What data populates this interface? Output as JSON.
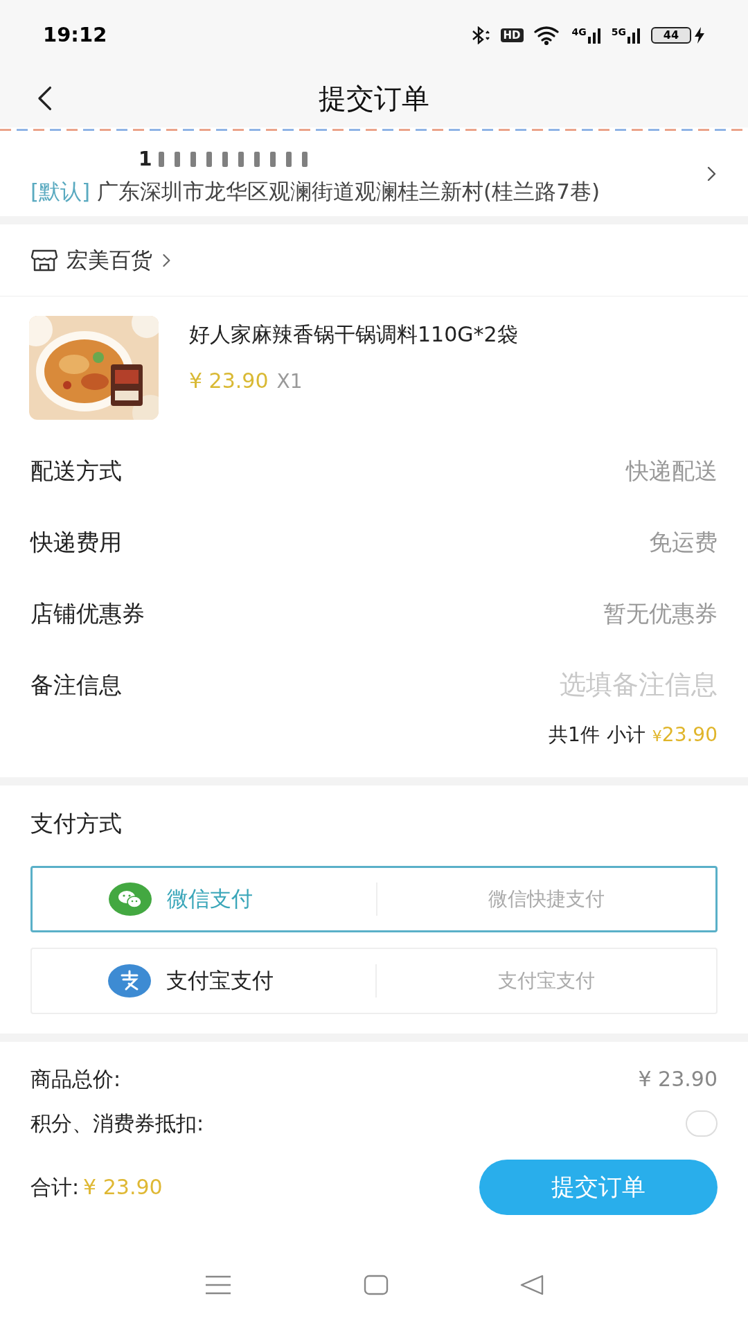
{
  "status_bar": {
    "time": "19:12",
    "hd": "HD",
    "networks": [
      "4G",
      "5G"
    ],
    "battery": "44"
  },
  "header": {
    "title": "提交订单"
  },
  "address": {
    "phone": "1",
    "tag": "[默认]",
    "text": "广东深圳市龙华区观澜街道观澜桂兰新村(桂兰路7巷)"
  },
  "shop": {
    "name": "宏美百货"
  },
  "product": {
    "name": "好人家麻辣香锅干锅调料110G*2袋",
    "price": "¥ 23.90",
    "quantity": "X1"
  },
  "details": [
    {
      "kind": "value",
      "label": "配送方式",
      "value": "快递配送"
    },
    {
      "kind": "value",
      "label": "快递费用",
      "value": "免运费"
    },
    {
      "kind": "value",
      "label": "店铺优惠券",
      "value": "暂无优惠券"
    },
    {
      "kind": "input",
      "label": "备注信息",
      "placeholder": "选填备注信息"
    }
  ],
  "subtotal": {
    "count": "共1件",
    "label": "小计",
    "yen": "¥",
    "amount": "23.90"
  },
  "payment": {
    "title": "支付方式",
    "methods": [
      {
        "kind": "wechat",
        "name": "微信支付",
        "desc": "微信快捷支付",
        "selected": true
      },
      {
        "kind": "alipay",
        "name": "支付宝支付",
        "desc": "支付宝支付",
        "selected": false
      }
    ]
  },
  "summary": {
    "goods_label": "商品总价:",
    "goods_total": "¥ 23.90",
    "points_label": "积分、消费券抵扣:",
    "points_checked": false,
    "total_label": "合计:",
    "total": "¥ 23.90",
    "submit": "提交订单"
  }
}
